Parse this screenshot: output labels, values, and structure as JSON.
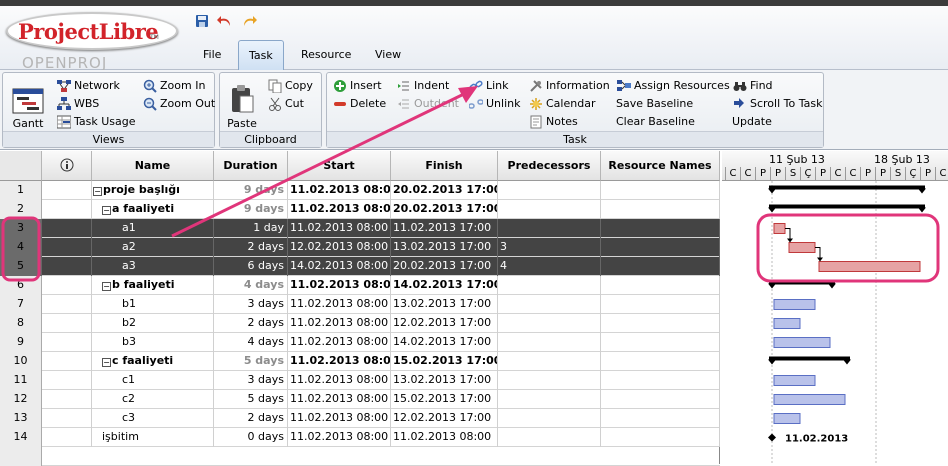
{
  "app": {
    "logo_main": "ProjectLibre",
    "logo_tm": "TM",
    "logo_sub": "OPENPROJ"
  },
  "qat": {
    "save_icon": "save-icon",
    "undo_icon": "undo-icon",
    "redo_icon": "redo-icon"
  },
  "menu_tabs": [
    "File",
    "Task",
    "Resource",
    "View"
  ],
  "active_tab": "Task",
  "ribbon": {
    "views": {
      "label": "Views",
      "gantt": "Gantt",
      "network": "Network",
      "wbs": "WBS",
      "task_usage": "Task Usage",
      "zoom_in": "Zoom In",
      "zoom_out": "Zoom Out"
    },
    "clipboard": {
      "label": "Clipboard",
      "paste": "Paste",
      "copy": "Copy",
      "cut": "Cut"
    },
    "task": {
      "label": "Task",
      "insert": "Insert",
      "delete": "Delete",
      "indent": "Indent",
      "outdent": "Outdent",
      "link": "Link",
      "unlink": "Unlink",
      "information": "Information",
      "calendar": "Calendar",
      "notes": "Notes",
      "assign_resources": "Assign Resources",
      "save_baseline": "Save Baseline",
      "clear_baseline": "Clear Baseline",
      "find": "Find",
      "scroll_to_task": "Scroll To Task",
      "update": "Update"
    }
  },
  "table": {
    "headers": {
      "indicators": "ⓘ",
      "name": "Name",
      "duration": "Duration",
      "start": "Start",
      "finish": "Finish",
      "predecessors": "Predecessors",
      "resources": "Resource Names"
    },
    "rows": [
      {
        "id": "1",
        "name": "proje başlığı",
        "duration": "9 days",
        "start": "11.02.2013 08:00",
        "finish": "20.02.2013 17:00",
        "pred": "",
        "summary": true,
        "level": 0,
        "selected": false
      },
      {
        "id": "2",
        "name": "a faaliyeti",
        "duration": "9 days",
        "start": "11.02.2013 08:00",
        "finish": "20.02.2013 17:00",
        "pred": "",
        "summary": true,
        "level": 1,
        "selected": false
      },
      {
        "id": "3",
        "name": "a1",
        "duration": "1 day",
        "start": "11.02.2013 08:00",
        "finish": "11.02.2013 17:00",
        "pred": "",
        "summary": false,
        "level": 2,
        "selected": true
      },
      {
        "id": "4",
        "name": "a2",
        "duration": "2 days",
        "start": "12.02.2013 08:00",
        "finish": "13.02.2013 17:00",
        "pred": "3",
        "summary": false,
        "level": 2,
        "selected": true
      },
      {
        "id": "5",
        "name": "a3",
        "duration": "6 days",
        "start": "14.02.2013 08:00",
        "finish": "20.02.2013 17:00",
        "pred": "4",
        "summary": false,
        "level": 2,
        "selected": true
      },
      {
        "id": "6",
        "name": "b faaliyeti",
        "duration": "4 days",
        "start": "11.02.2013 08:00",
        "finish": "14.02.2013 17:00",
        "pred": "",
        "summary": true,
        "level": 1,
        "selected": false
      },
      {
        "id": "7",
        "name": "b1",
        "duration": "3 days",
        "start": "11.02.2013 08:00",
        "finish": "13.02.2013 17:00",
        "pred": "",
        "summary": false,
        "level": 2,
        "selected": false
      },
      {
        "id": "8",
        "name": "b2",
        "duration": "2 days",
        "start": "11.02.2013 08:00",
        "finish": "12.02.2013 17:00",
        "pred": "",
        "summary": false,
        "level": 2,
        "selected": false
      },
      {
        "id": "9",
        "name": "b3",
        "duration": "4 days",
        "start": "11.02.2013 08:00",
        "finish": "14.02.2013 17:00",
        "pred": "",
        "summary": false,
        "level": 2,
        "selected": false
      },
      {
        "id": "10",
        "name": "c faaliyeti",
        "duration": "5 days",
        "start": "11.02.2013 08:00",
        "finish": "15.02.2013 17:00",
        "pred": "",
        "summary": true,
        "level": 1,
        "selected": false
      },
      {
        "id": "11",
        "name": "c1",
        "duration": "3 days",
        "start": "11.02.2013 08:00",
        "finish": "13.02.2013 17:00",
        "pred": "",
        "summary": false,
        "level": 2,
        "selected": false
      },
      {
        "id": "12",
        "name": "c2",
        "duration": "5 days",
        "start": "11.02.2013 08:00",
        "finish": "15.02.2013 17:00",
        "pred": "",
        "summary": false,
        "level": 2,
        "selected": false
      },
      {
        "id": "13",
        "name": "c3",
        "duration": "2 days",
        "start": "11.02.2013 08:00",
        "finish": "12.02.2013 17:00",
        "pred": "",
        "summary": false,
        "level": 2,
        "selected": false
      },
      {
        "id": "14",
        "name": "işbitim",
        "duration": "0 days",
        "start": "11.02.2013 08:00",
        "finish": "11.02.2013 08:00",
        "pred": "",
        "summary": false,
        "level": 1,
        "selected": false,
        "milestone": true
      }
    ]
  },
  "gantt": {
    "weeks": [
      "11 Şub 13",
      "18 Şub 13"
    ],
    "days": [
      "C",
      "C",
      "P",
      "P",
      "S",
      "Ç",
      "P",
      "C",
      "C",
      "P",
      "P",
      "S",
      "Ç",
      "P",
      "C"
    ],
    "milestone_label": "11.02.2013",
    "colors": {
      "task": "#5a6fc4",
      "task_fill": "#b9c2ea",
      "critical": "#c0393b",
      "critical_fill": "#e6a3a4",
      "summary": "#000000",
      "highlight": "#e0357a"
    }
  },
  "annotation": {
    "color": "#e0357a"
  }
}
